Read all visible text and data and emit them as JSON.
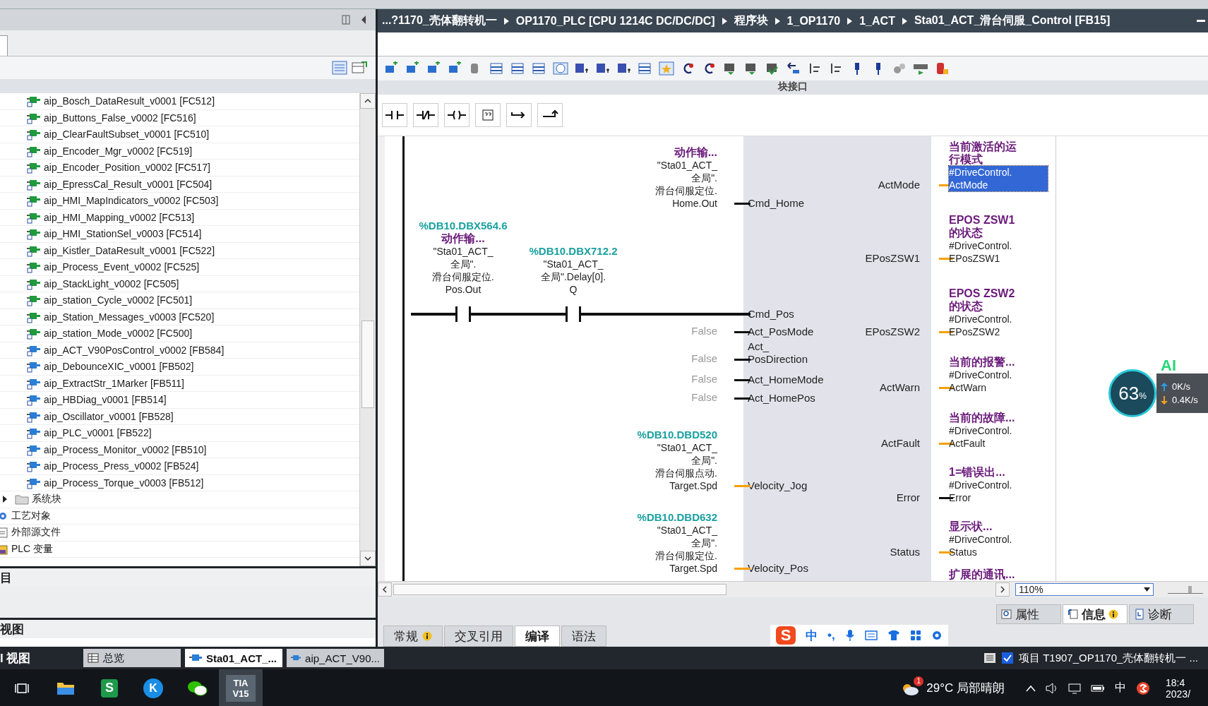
{
  "left_panel": {
    "tree": [
      {
        "children": [
          {
            "children": [
              {
                "label": "aip_Bosch_DataResult_v0001 [FC512]",
                "kind": "fc"
              },
              {
                "label": "aip_Buttons_False_v0002 [FC516]",
                "kind": "fc"
              },
              {
                "label": "aip_ClearFaultSubset_v0001 [FC510]",
                "kind": "fc"
              },
              {
                "label": "aip_Encoder_Mgr_v0002 [FC519]",
                "kind": "fc"
              },
              {
                "label": "aip_Encoder_Position_v0002 [FC517]",
                "kind": "fc"
              },
              {
                "label": "aip_EpressCal_Result_v0001 [FC504]",
                "kind": "fc"
              },
              {
                "label": "aip_HMI_MapIndicators_v0002 [FC503]",
                "kind": "fc"
              },
              {
                "label": "aip_HMI_Mapping_v0002 [FC513]",
                "kind": "fc"
              },
              {
                "label": "aip_HMI_StationSel_v0003 [FC514]",
                "kind": "fc"
              },
              {
                "label": "aip_Kistler_DataResult_v0001 [FC522]",
                "kind": "fc"
              },
              {
                "label": "aip_Process_Event_v0002 [FC525]",
                "kind": "fc"
              },
              {
                "label": "aip_StackLight_v0002 [FC505]",
                "kind": "fc"
              },
              {
                "label": "aip_station_Cycle_v0002 [FC501]",
                "kind": "fc"
              },
              {
                "label": "aip_Station_Messages_v0003 [FC520]",
                "kind": "fc"
              },
              {
                "label": "aip_station_Mode_v0002 [FC500]",
                "kind": "fc"
              },
              {
                "label": "aip_ACT_V90PosControl_v0002 [FB584]",
                "kind": "fb"
              },
              {
                "label": "aip_DebounceXIC_v0001 [FB502]",
                "kind": "fb"
              },
              {
                "label": "aip_ExtractStr_1Marker [FB511]",
                "kind": "fb"
              },
              {
                "label": "aip_HBDiag_v0001 [FB514]",
                "kind": "fb"
              },
              {
                "label": "aip_Oscillator_v0001 [FB528]",
                "kind": "fb"
              },
              {
                "label": "aip_PLC_v0001 [FB522]",
                "kind": "fb"
              },
              {
                "label": "aip_Process_Monitor_v0002 [FB510]",
                "kind": "fb"
              },
              {
                "label": "aip_Process_Press_v0002 [FB524]",
                "kind": "fb"
              },
              {
                "label": "aip_Process_Torque_v0003 [FB512]",
                "kind": "fb"
              }
            ]
          },
          {
            "label": "系统块",
            "kind": "system",
            "expanded": false
          }
        ]
      },
      {
        "label": "工艺对象",
        "kind": "tech"
      },
      {
        "label": "外部源文件",
        "kind": "source"
      },
      {
        "label": "PLC 变量",
        "kind": "tags"
      }
    ],
    "details_header": "目",
    "view_header": "视图"
  },
  "editor": {
    "breadcrumb": [
      "...?1170_壳体翻转机一",
      "OP1170_PLC [CPU 1214C DC/DC/DC]",
      "程序块",
      "1_OP1170",
      "1_ACT",
      "Sta01_ACT_滑台伺服_Control [FB15]"
    ],
    "interface_label": "块接口",
    "network": {
      "inputs": [
        {
          "pin": "Cmd_Home",
          "color": "#111111",
          "kind": "variable",
          "comment": "动作输...",
          "operand": "\"Sta01_ACT_\n全局\".\n滑台伺服定位.\nHome.Out"
        },
        {
          "pin": "Cmd_Pos",
          "color": "#111111",
          "kind": "rung",
          "contacts": [
            {
              "kind": "no",
              "address": "%DB10.DBX564.6",
              "comment": "动作输...",
              "operand": "\"Sta01_ACT_\n全局\".\n滑台伺服定位.\nPos.Out"
            },
            {
              "kind": "no",
              "address": "%DB10.DBX712.2",
              "operand": "\"Sta01_ACT_\n全局\".Delay[0].\nQ"
            }
          ]
        },
        {
          "pin": "Act_PosMode",
          "color": "#111111",
          "kind": "constant",
          "value": "False"
        },
        {
          "pin": "Act_\nPosDirection",
          "color": "#111111",
          "kind": "constant",
          "value": "False"
        },
        {
          "pin": "Act_HomeMode",
          "color": "#111111",
          "kind": "constant",
          "value": "False"
        },
        {
          "pin": "Act_HomePos",
          "color": "#111111",
          "kind": "constant",
          "value": "False"
        },
        {
          "pin": "Velocity_Jog",
          "color": "#f5a000",
          "kind": "variable",
          "address": "%DB10.DBD520",
          "operand": "\"Sta01_ACT_\n全局\".\n滑台伺服点动.\nTarget.Spd"
        },
        {
          "pin": "Velocity_Pos",
          "color": "#f5a000",
          "kind": "variable",
          "address": "%DB10.DBD632",
          "operand": "\"Sta01_ACT_\n全局\".\n滑台伺服定位.\nTarget.Spd"
        }
      ],
      "outputs": [
        {
          "pin": "ActMode",
          "color": "#f5a000",
          "comment": "当前激活的运行模式",
          "operand": "#DriveControl.\nActMode",
          "selected": true
        },
        {
          "pin": "EPosZSW1",
          "color": "#f5a000",
          "comment": "EPOS ZSW1 的状态",
          "operand": "#DriveControl.\nEPosZSW1",
          "selected": false
        },
        {
          "pin": "EPosZSW2",
          "color": "#f5a000",
          "comment": "EPOS ZSW2 的状态",
          "operand": "#DriveControl.\nEPosZSW2",
          "selected": false
        },
        {
          "pin": "ActWarn",
          "color": "#f5a000",
          "comment": "当前的报警...",
          "operand": "#DriveControl.\nActWarn",
          "selected": false
        },
        {
          "pin": "ActFault",
          "color": "#f5a000",
          "comment": "当前的故障...",
          "operand": "#DriveControl.\nActFault",
          "selected": false
        },
        {
          "pin": "Error",
          "color": "#111111",
          "comment": "1=错误出...",
          "operand": "#DriveControl.\nError",
          "selected": false
        },
        {
          "pin": "Status",
          "color": "#f5a000",
          "comment": "显示状...",
          "operand": "#DriveControl.\nStatus",
          "selected": false
        },
        {
          "comment": "扩展的通讯..."
        }
      ]
    },
    "zoom": "110%",
    "zoom_slider": {
      "level": 0.65
    },
    "inspector_tabs": [
      {
        "label": "属性",
        "kind": "props",
        "selected": false,
        "info": false
      },
      {
        "label": "信息",
        "kind": "info",
        "selected": true,
        "info": true
      },
      {
        "label": "诊断",
        "kind": "diag",
        "selected": false,
        "info": false
      }
    ],
    "result_tabs": [
      {
        "label": "常规",
        "selected": false,
        "info": true
      },
      {
        "label": "交叉引用",
        "selected": false,
        "info": false
      },
      {
        "label": "编译",
        "selected": true,
        "info": false
      },
      {
        "label": "语法",
        "selected": false,
        "info": false
      }
    ]
  },
  "ime_bar": {
    "logo": "S",
    "mode": "中",
    "punct": "•,"
  },
  "portal_bar": {
    "view_label": "l 视图",
    "editors": [
      {
        "label": "总览",
        "kind": "overview",
        "selected": false
      },
      {
        "label": "Sta01_ACT_...",
        "kind": "block",
        "selected": true
      },
      {
        "label": "aip_ACT_V90...",
        "kind": "block",
        "selected": false
      }
    ],
    "status": "项目 T1907_OP1170_壳体翻转机一 ..."
  },
  "net_monitor": {
    "badge": "AI",
    "percent": "63",
    "unit": "%",
    "up": "0K/s",
    "down": "0.4K/s"
  },
  "taskbar": {
    "apps": [
      {
        "kind": "taskview",
        "selected": false
      },
      {
        "kind": "explorer",
        "selected": false
      },
      {
        "kind": "sheet",
        "glyph": "S",
        "selected": false
      },
      {
        "kind": "kapp",
        "glyph": "K",
        "selected": false
      },
      {
        "kind": "chat",
        "selected": false
      },
      {
        "kind": "tia",
        "glyph": "TIA\nV15",
        "selected": true
      }
    ],
    "weather": {
      "badge": "1",
      "text": "29°C 局部晴朗"
    },
    "ime": "中",
    "time": "18:4",
    "date": "2023/"
  }
}
